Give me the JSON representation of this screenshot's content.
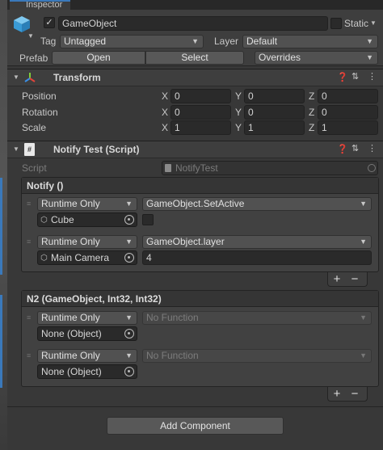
{
  "window": {
    "tab_title": "Inspector"
  },
  "header": {
    "active_checked": "✓",
    "object_name": "GameObject",
    "static_label": "Static",
    "tag_label": "Tag",
    "tag_value": "Untagged",
    "layer_label": "Layer",
    "layer_value": "Default",
    "prefab_label": "Prefab",
    "open_label": "Open",
    "select_label": "Select",
    "overrides_label": "Overrides"
  },
  "transform": {
    "title": "Transform",
    "rows": [
      {
        "label": "Position",
        "x": "0",
        "y": "0",
        "z": "0"
      },
      {
        "label": "Rotation",
        "x": "0",
        "y": "0",
        "z": "0"
      },
      {
        "label": "Scale",
        "x": "1",
        "y": "1",
        "z": "1"
      }
    ],
    "axis": {
      "x": "X",
      "y": "Y",
      "z": "Z"
    }
  },
  "notify": {
    "title": "Notify Test (Script)",
    "script_label": "Script",
    "script_value": "NotifyTest",
    "events": [
      {
        "header": "Notify ()",
        "entries": [
          {
            "mode": "Runtime Only",
            "function": "GameObject.SetActive",
            "target": "Cube",
            "arg": ""
          },
          {
            "mode": "Runtime Only",
            "function": "GameObject.layer",
            "target": "Main Camera",
            "arg": "4"
          }
        ]
      },
      {
        "header": "N2 (GameObject, Int32, Int32)",
        "entries": [
          {
            "mode": "Runtime Only",
            "function": "No Function",
            "target": "None (Object)"
          },
          {
            "mode": "Runtime Only",
            "function": "No Function",
            "target": "None (Object)"
          }
        ]
      }
    ],
    "plus": "+",
    "minus": "−"
  },
  "footer": {
    "add_component": "Add Component"
  },
  "colors": {
    "background": "#383838",
    "accent": "#3a79bb",
    "field": "#2a2a2a"
  },
  "icons": [
    "gameobject-cube-icon",
    "transform-axes-icon",
    "script-file-icon",
    "help-icon",
    "preset-sliders-icon",
    "context-menu-icon",
    "object-picker-icon",
    "cube-icon",
    "drag-handle-icon"
  ]
}
